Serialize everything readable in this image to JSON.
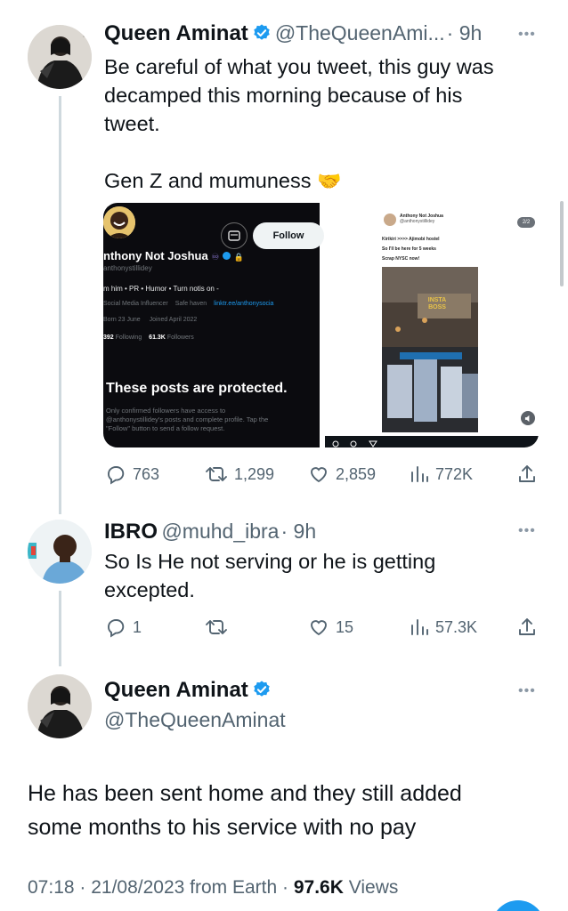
{
  "tweet1": {
    "name": "Queen Aminat",
    "handle": "@TheQueenAmi...",
    "time": "· 9h",
    "text_line1": "Be careful of what you tweet, this guy was",
    "text_line2": "decamped this morning because of his",
    "text_line3": "tweet.",
    "text_line4": "Gen Z and mumuness",
    "emoji": "🤝",
    "replies": "763",
    "retweets": "1,299",
    "likes": "2,859",
    "views": "772K"
  },
  "media_left": {
    "follow_label": "Follow",
    "profile_name": "nthony Not Joshua",
    "profile_handle": "anthonystillidey",
    "bio": "m him • PR • Humor • Turn notis on -",
    "meta1": "Social Media Influencer",
    "meta2": "Safe haven",
    "meta3": "linktr.ee/anthonysocia",
    "meta4": "Born 23 June",
    "meta5": "Joined April 2022",
    "following_count": "392",
    "following_label": "Following",
    "followers_count": "61.3K",
    "followers_label": "Followers",
    "protected_title": "These posts are protected.",
    "protected_line1": "Only confirmed followers have access to",
    "protected_line2": "@anthonystillidey's posts and complete profile. Tap the",
    "protected_line3": "\"Follow\" button to send a follow request."
  },
  "media_right": {
    "page_badge": "2/2",
    "mini_name": "Anthony Not Joshua",
    "mini_handle": "@anthonystillidey",
    "line1": "Kirikiri >>>> Ajimobi hostel",
    "line2": "So I'll be here for 5 weeks",
    "line3": "Scrap NYSC now!",
    "sign_text": "INSTA BOSS"
  },
  "tweet2": {
    "name": "IBRO",
    "handle": "@muhd_ibra",
    "time": "· 9h",
    "text_line1": "So Is He not serving or he is getting",
    "text_line2": "excepted.",
    "replies": "1",
    "retweets": "",
    "likes": "15",
    "views": "57.3K"
  },
  "tweet3": {
    "name": "Queen Aminat",
    "handle": "@TheQueenAminat",
    "text_line1": "He has been sent home and they still added",
    "text_line2": "some months to his service with no pay",
    "meta_time": "07:18 · 21/08/2023 from Earth · ",
    "views_count": "97.6K",
    "views_label": " Views"
  },
  "colors": {
    "verified": "#1d9bf0",
    "muted": "#536471",
    "thread": "#cfd9de",
    "fab": "#1d9bf0"
  },
  "icons": [
    "verified-icon",
    "more-icon",
    "reply-icon",
    "retweet-icon",
    "like-icon",
    "views-icon",
    "share-icon"
  ]
}
